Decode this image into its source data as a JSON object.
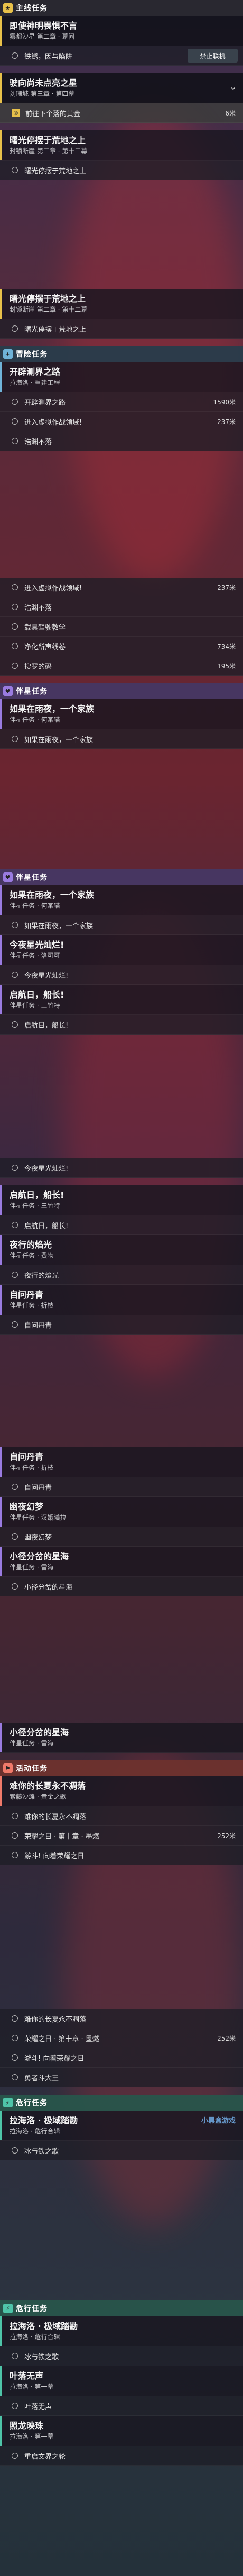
{
  "colors": {
    "main": "#e8c14a",
    "side": "#6fb3d8",
    "companion": "#9a7be0",
    "event": "#f07a6a",
    "daily": "#4ec4a8"
  },
  "p1": {
    "header": {
      "title": "主线任务",
      "icon": "star-icon"
    },
    "quests": [
      {
        "title": "即使神明畏惧不言",
        "sub": "雾都沙星 第二章 · 幕间",
        "steps": [
          "铁锈，因与陷阱"
        ],
        "button": "禁止联机"
      },
      {
        "title": "驶向尚未点亮之星",
        "sub": "刘珊城 第三章 · 第四幕",
        "steps": [
          {
            "text": "前往下个落的黄金",
            "dist": "6米"
          }
        ]
      },
      {
        "title": "曙光停摆于荒地之上",
        "sub": "封锁断崖 第二章 · 第十二幕",
        "steps": [
          "曙光停摆于荒地之上"
        ]
      }
    ]
  },
  "p2": {
    "quests": [
      {
        "title": "曙光停摆于荒地之上",
        "sub": "封锁断崖 第二章 · 第十二幕",
        "steps": [
          "曙光停摆于荒地之上"
        ]
      }
    ],
    "header": {
      "title": "冒险任务",
      "icon": "compass-icon"
    },
    "quest2": {
      "title": "开辟测界之路",
      "sub": "拉海洛 · 重建工程",
      "steps": [
        {
          "text": "开辟测界之路",
          "dist": "1590米"
        },
        {
          "text": "进入虚拟作战领域!",
          "dist": "237米"
        },
        {
          "text": "浩渊不落",
          "dist": ""
        }
      ]
    }
  },
  "p3": {
    "steps": [
      {
        "text": "进入虚拟作战领域!",
        "dist": "237米"
      },
      {
        "text": "浩渊不落",
        "dist": ""
      },
      {
        "text": "载具驾驶教学",
        "dist": ""
      },
      {
        "text": "净化所声线卷",
        "dist": "734米"
      },
      {
        "text": "搜罗的码",
        "dist": "195米"
      }
    ],
    "header": {
      "title": "伴星任务",
      "icon": "heart-icon"
    },
    "quest": {
      "title": "如果在雨夜，一个家族",
      "sub": "伴星任务 · 何某猫",
      "steps": [
        "如果在雨夜，一个家族"
      ]
    }
  },
  "p4": {
    "header": {
      "title": "伴星任务",
      "icon": "heart-icon"
    },
    "quests": [
      {
        "title": "如果在雨夜，一个家族",
        "sub": "伴星任务 · 何某猫",
        "steps": [
          "如果在雨夜，一个家族"
        ]
      },
      {
        "title": "今夜星光灿烂!",
        "sub": "伴星任务 · 洛可可",
        "steps": [
          "今夜星光灿烂!"
        ]
      },
      {
        "title": "启航日，船长!",
        "sub": "伴星任务 · 三竹特",
        "steps": [
          "启航日，船长!"
        ]
      }
    ]
  },
  "p5": {
    "steps0": [
      "今夜星光灿烂!"
    ],
    "quests": [
      {
        "title": "启航日，船长!",
        "sub": "伴星任务 · 三竹特",
        "steps": [
          "启航日，船长!"
        ]
      },
      {
        "title": "夜行的焰光",
        "sub": "伴星任务 · 费物",
        "steps": [
          "夜行的焰光"
        ]
      },
      {
        "title": "自问丹青",
        "sub": "伴星任务 · 折枝",
        "steps": [
          "自问丹青"
        ]
      }
    ]
  },
  "p6": {
    "quests": [
      {
        "title": "自问丹青",
        "sub": "伴星任务 · 折枝",
        "steps": [
          "自问丹青"
        ]
      },
      {
        "title": "幽夜幻梦",
        "sub": "伴星任务 · 汉娥曦拉",
        "steps": [
          "幽夜幻梦"
        ]
      },
      {
        "title": "小径分岔的星海",
        "sub": "伴星任务 · 雷海",
        "steps": [
          "小径分岔的星海"
        ]
      }
    ]
  },
  "p7": {
    "quests": [
      {
        "title": "小径分岔的星海",
        "sub": "伴星任务 · 雷海",
        "steps": []
      }
    ],
    "header": {
      "title": "活动任务",
      "icon": "flag-icon"
    },
    "quest2": {
      "title": "难你的长夏永不凋落",
      "sub": "紫藤沙滩 · 黄金之歌",
      "steps": [
        {
          "text": "难你的长夏永不凋落",
          "dist": ""
        },
        {
          "text": "荣耀之日 · 第十章 · 墨燃",
          "dist": "252米"
        },
        {
          "text": "游斗! 向着荣耀之日",
          "dist": ""
        }
      ]
    }
  },
  "p8": {
    "steps": [
      {
        "text": "难你的长夏永不凋落",
        "dist": ""
      },
      {
        "text": "荣耀之日 · 第十章 · 墨燃",
        "dist": "252米"
      },
      {
        "text": "游斗! 向着荣耀之日",
        "dist": ""
      },
      {
        "text": "勇者斗大王",
        "dist": ""
      }
    ],
    "header": {
      "title": "危行任务",
      "icon": "bolt-icon"
    },
    "quest": {
      "title": "拉海洛 · 极域踏勘",
      "sub": "拉海洛 · 危行合辑",
      "steps": [
        "冰与铁之歌"
      ]
    }
  },
  "p9": {
    "header": {
      "title": "危行任务",
      "icon": "bolt-icon"
    },
    "quests": [
      {
        "title": "拉海洛 · 极域踏勘",
        "sub": "拉海洛 · 危行合辑",
        "steps": [
          "冰与铁之歌"
        ]
      },
      {
        "title": "叶落无声",
        "sub": "拉海洛 · 第一幕",
        "steps": [
          "叶落无声"
        ]
      },
      {
        "title": "照龙映珠",
        "sub": "拉海洛 · 第一幕",
        "steps": [
          "重启文界之轮"
        ]
      }
    ]
  },
  "watermark": "小黑盒游戏"
}
